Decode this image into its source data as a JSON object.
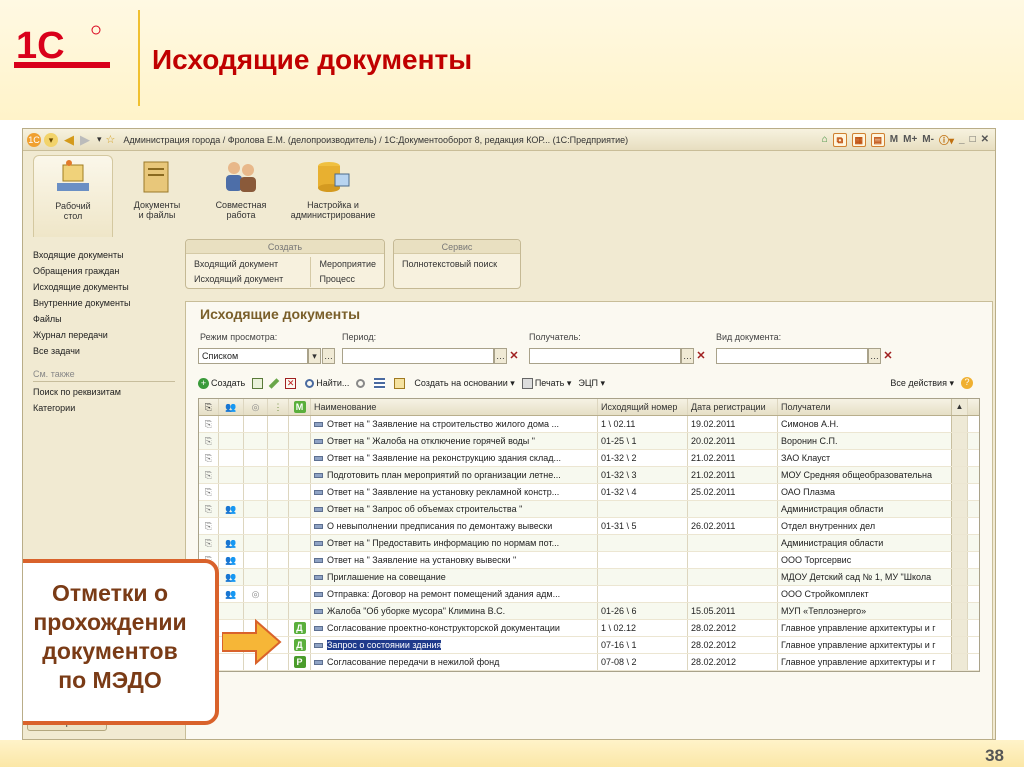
{
  "slide": {
    "title": "Исходящие документы",
    "page_number": "38",
    "callout_lines": [
      "Отметки о",
      "прохождении",
      "документов",
      "по МЭДО"
    ]
  },
  "window": {
    "title": "Администрация города / Фролова Е.М. (делопроизводитель) / 1С:Документооборот 8, редакция КОР...   (1С:Предприятие)",
    "tb_m": "M",
    "tb_mplus": "M+",
    "tb_mminus": "M-"
  },
  "sections": [
    {
      "label1": "Рабочий",
      "label2": "стол",
      "icon": "desk-icon"
    },
    {
      "label1": "Документы",
      "label2": "и файлы",
      "icon": "folder-icon"
    },
    {
      "label1": "Совместная",
      "label2": "работа",
      "icon": "people-icon"
    },
    {
      "label1": "Настройка и",
      "label2": "администрирование",
      "icon": "database-icon"
    }
  ],
  "nav": {
    "items": [
      "Входящие документы",
      "Обращения граждан",
      "Исходящие документы",
      "Внутренние документы",
      "Файлы",
      "Журнал передачи",
      "Все задачи"
    ],
    "see_also": "См. также",
    "extra": [
      "Поиск по реквизитам",
      "Категории"
    ],
    "history": "История..."
  },
  "groups": {
    "create": {
      "title": "Создать",
      "items": [
        "Входящий документ",
        "Мероприятие",
        "Исходящий документ",
        "Процесс"
      ]
    },
    "service": {
      "title": "Сервис",
      "items": [
        "Полнотекстовый поиск"
      ]
    }
  },
  "form": {
    "title": "Исходящие документы",
    "filters": {
      "mode_label": "Режим просмотра:",
      "mode_value": "Списком",
      "period_label": "Период:",
      "period_value": "",
      "recipient_label": "Получатель:",
      "recipient_value": "",
      "doctype_label": "Вид документа:",
      "doctype_value": ""
    },
    "toolbar": {
      "create": "Создать",
      "find": "Найти...",
      "create_based": "Создать на основании",
      "print": "Печать",
      "ecp": "ЭЦП",
      "all_actions": "Все действия"
    },
    "columns": {
      "name": "Наименование",
      "out_number": "Исходящий номер",
      "reg_date": "Дата регистрации",
      "recipients": "Получатели",
      "m": "M"
    },
    "rows": [
      {
        "name": "Ответ на \" Заявление на строительство жилого дома ...",
        "num": "1 \\ 02.11",
        "date": "19.02.2011",
        "rcpt": "Симонов А.Н.",
        "users": false,
        "circle": false,
        "mark": ""
      },
      {
        "name": "Ответ на \" Жалоба на отключение горячей воды \"",
        "num": "01-25 \\ 1",
        "date": "20.02.2011",
        "rcpt": "Воронин С.П.",
        "users": false,
        "circle": false,
        "mark": ""
      },
      {
        "name": "Ответ на \" Заявление на реконструкцию здания склад...",
        "num": "01-32 \\ 2",
        "date": "21.02.2011",
        "rcpt": "ЗАО Клауст",
        "users": false,
        "circle": false,
        "mark": ""
      },
      {
        "name": "Подготовить план мероприятий по организации летне...",
        "num": "01-32 \\ 3",
        "date": "21.02.2011",
        "rcpt": "МОУ Средняя общеобразовательна",
        "users": false,
        "circle": false,
        "mark": ""
      },
      {
        "name": "Ответ на \" Заявление на установку рекламной констр...",
        "num": "01-32 \\ 4",
        "date": "25.02.2011",
        "rcpt": "ОАО Плазма",
        "users": false,
        "circle": false,
        "mark": ""
      },
      {
        "name": "Ответ на \" Запрос об объемах строительства \"",
        "num": "",
        "date": "",
        "rcpt": "Администрация области",
        "users": true,
        "circle": false,
        "mark": ""
      },
      {
        "name": "О невыполнении предписания по демонтажу вывески",
        "num": "01-31 \\ 5",
        "date": "26.02.2011",
        "rcpt": "Отдел внутренних дел",
        "users": false,
        "circle": false,
        "mark": ""
      },
      {
        "name": "Ответ на \" Предоставить информацию по нормам пот...",
        "num": "",
        "date": "",
        "rcpt": "Администрация области",
        "users": true,
        "circle": false,
        "mark": ""
      },
      {
        "name": "Ответ на \" Заявление на установку вывески \"",
        "num": "",
        "date": "",
        "rcpt": "ООО Торгсервис",
        "users": true,
        "circle": false,
        "mark": ""
      },
      {
        "name": "Приглашение на совещание",
        "num": "",
        "date": "",
        "rcpt": "МДОУ Детский сад № 1, МУ \"Школа",
        "users": true,
        "circle": false,
        "mark": ""
      },
      {
        "name": "Отправка: Договор на ремонт помещений здания адм...",
        "num": "",
        "date": "",
        "rcpt": "ООО Стройкомплект",
        "users": true,
        "circle": true,
        "mark": ""
      },
      {
        "name": "Жалоба \"Об уборке мусора\" Климина В.С.",
        "num": "01-26 \\ 6",
        "date": "15.05.2011",
        "rcpt": "МУП «Теплоэнерго»",
        "users": false,
        "circle": false,
        "mark": ""
      },
      {
        "name": "Согласование проектно-конструкторской документации",
        "num": "1 \\ 02.12",
        "date": "28.02.2012",
        "rcpt": "Главное управление архитектуры и г",
        "users": false,
        "circle": false,
        "mark": "Д"
      },
      {
        "name": "Запрос о состоянии здания",
        "num": "07-16 \\ 1",
        "date": "28.02.2012",
        "rcpt": "Главное управление архитектуры и г",
        "users": false,
        "circle": false,
        "mark": "Д",
        "selected": true
      },
      {
        "name": "Согласование передачи в нежилой фонд",
        "num": "07-08 \\ 2",
        "date": "28.02.2012",
        "rcpt": "Главное управление архитектуры и г",
        "users": false,
        "circle": false,
        "mark": "Р"
      }
    ]
  }
}
